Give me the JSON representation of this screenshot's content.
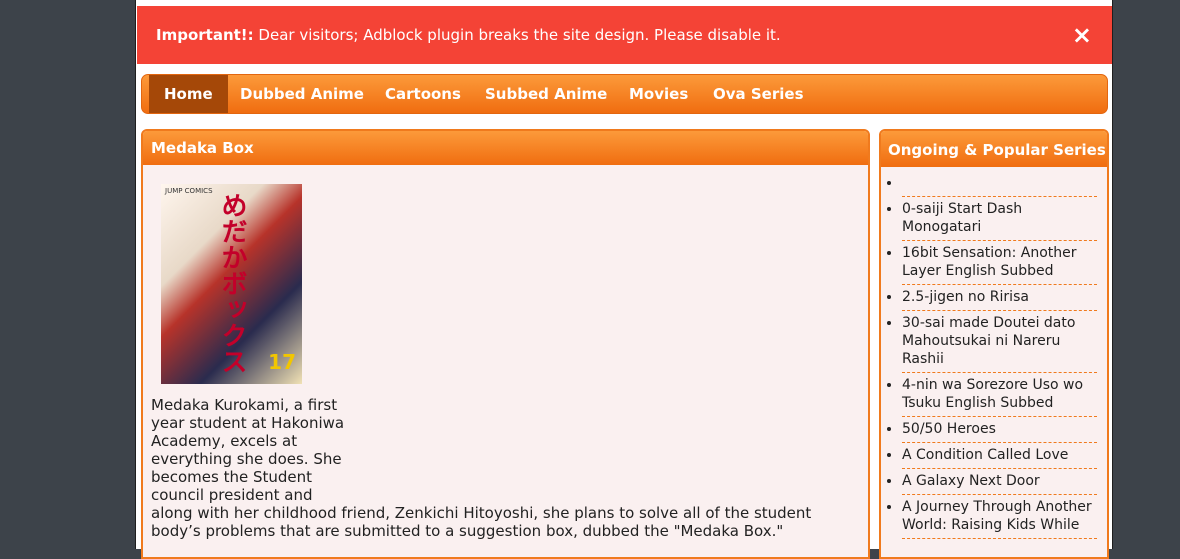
{
  "alert": {
    "strong": "Important!:",
    "message": "Dear visitors; Adblock plugin breaks the site design. Please disable it.",
    "close": "×"
  },
  "nav": {
    "items": [
      "Home",
      "Dubbed Anime",
      "Cartoons",
      "Subbed Anime",
      "Movies",
      "Ova Series"
    ],
    "active": "Home"
  },
  "main": {
    "title": "Medaka Box",
    "cover": {
      "publisher": "JUMP COMICS",
      "volume": "17",
      "title": "めだかボックス"
    },
    "description_narrow": "Medaka Kurokami, a first year student at Hakoniwa Academy, excels at everything she does. She becomes the Student council president and",
    "description_wide": "along with her childhood friend, Zenkichi Hitoyoshi, she plans to solve all of the student body’s problems that are submitted to a suggestion box, dubbed the \"Medaka Box.\""
  },
  "sidebar": {
    "title": "Ongoing & Popular Series",
    "items": [
      "",
      "0-saiji Start Dash Monogatari",
      "16bit Sensation: Another Layer English Subbed",
      "2.5-jigen no Ririsa",
      "30-sai made Doutei dato Mahoutsukai ni Nareru Rashii",
      "4-nin wa Sorezore Uso wo Tsuku English Subbed",
      "50/50 Heroes",
      "A Condition Called Love",
      "A Galaxy Next Door",
      "A Journey Through Another World: Raising Kids While"
    ]
  }
}
